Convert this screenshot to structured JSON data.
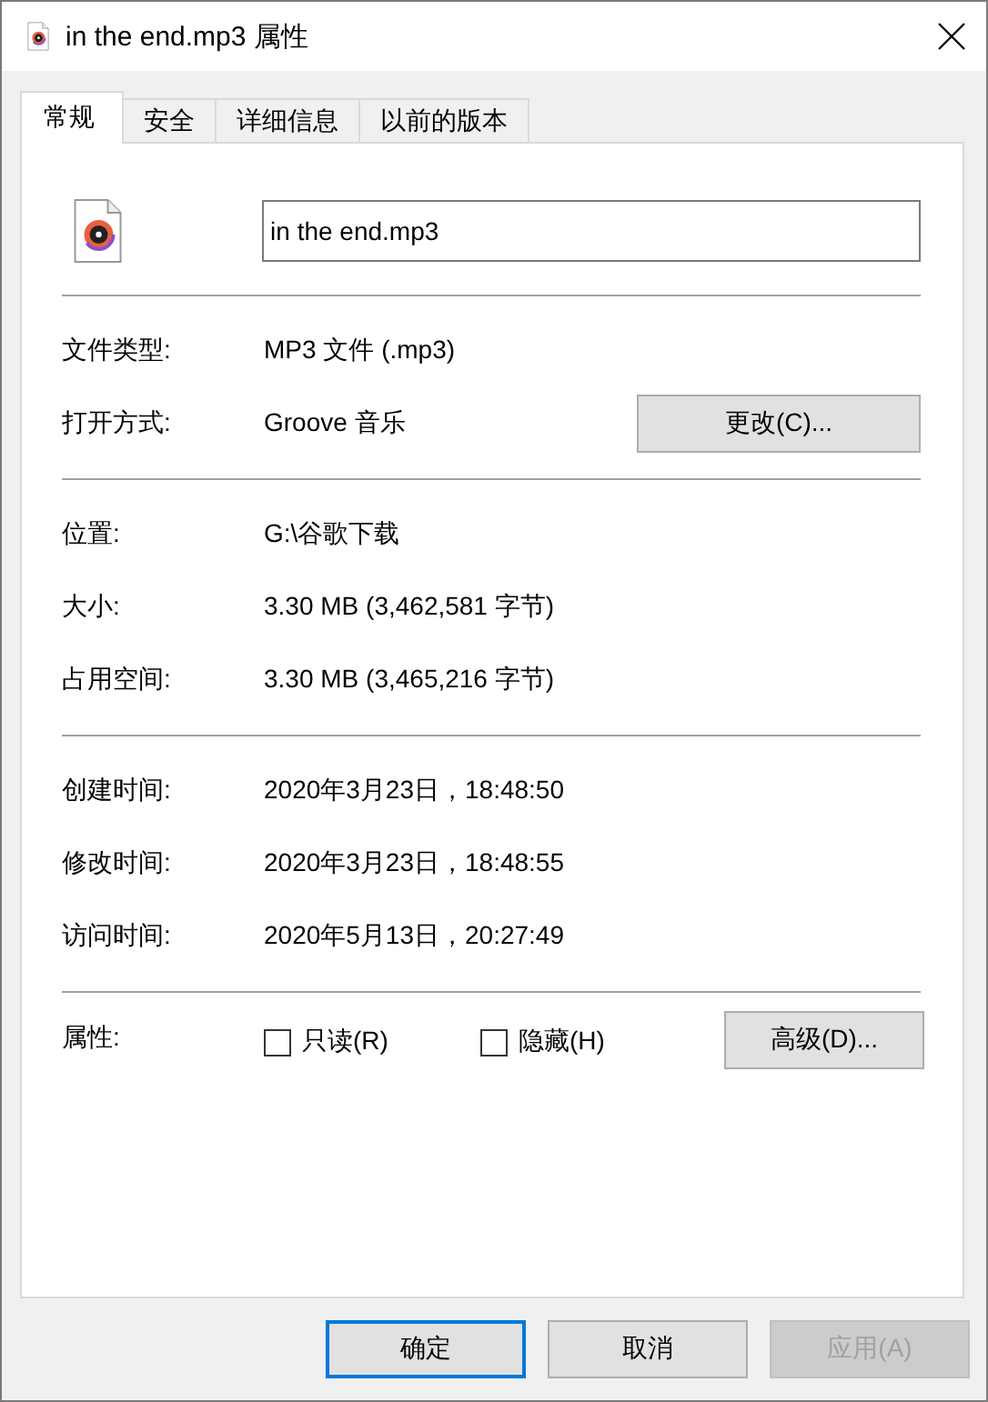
{
  "window": {
    "title": "in the end.mp3 属性"
  },
  "tabs": [
    {
      "label": "常规",
      "selected": true
    },
    {
      "label": "安全",
      "selected": false
    },
    {
      "label": "详细信息",
      "selected": false
    },
    {
      "label": "以前的版本",
      "selected": false
    }
  ],
  "file_name": {
    "value": "in the end.mp3"
  },
  "sections": [
    {
      "rows": [
        {
          "label": "文件类型:",
          "value": "MP3 文件 (.mp3)"
        },
        {
          "label": "打开方式:",
          "value": "Groove 音乐",
          "button": "更改(C)..."
        }
      ]
    },
    {
      "rows": [
        {
          "label": "位置:",
          "value": "G:\\谷歌下载"
        },
        {
          "label": "大小:",
          "value": "3.30 MB (3,462,581 字节)"
        },
        {
          "label": "占用空间:",
          "value": "3.30 MB (3,465,216 字节)"
        }
      ]
    },
    {
      "rows": [
        {
          "label": "创建时间:",
          "value": "2020年3月23日，18:48:50"
        },
        {
          "label": "修改时间:",
          "value": "2020年3月23日，18:48:55"
        },
        {
          "label": "访问时间:",
          "value": "2020年5月13日，20:27:49"
        }
      ]
    }
  ],
  "attributes": {
    "label": "属性:",
    "checkboxes": [
      {
        "label": "只读(R)",
        "checked": false
      },
      {
        "label": "隐藏(H)",
        "checked": false
      }
    ],
    "button": "高级(D)..."
  },
  "buttons": [
    {
      "label": "确定",
      "default": true,
      "disabled": false
    },
    {
      "label": "取消",
      "default": false,
      "disabled": false
    },
    {
      "label": "应用(A)",
      "default": false,
      "disabled": true
    }
  ]
}
